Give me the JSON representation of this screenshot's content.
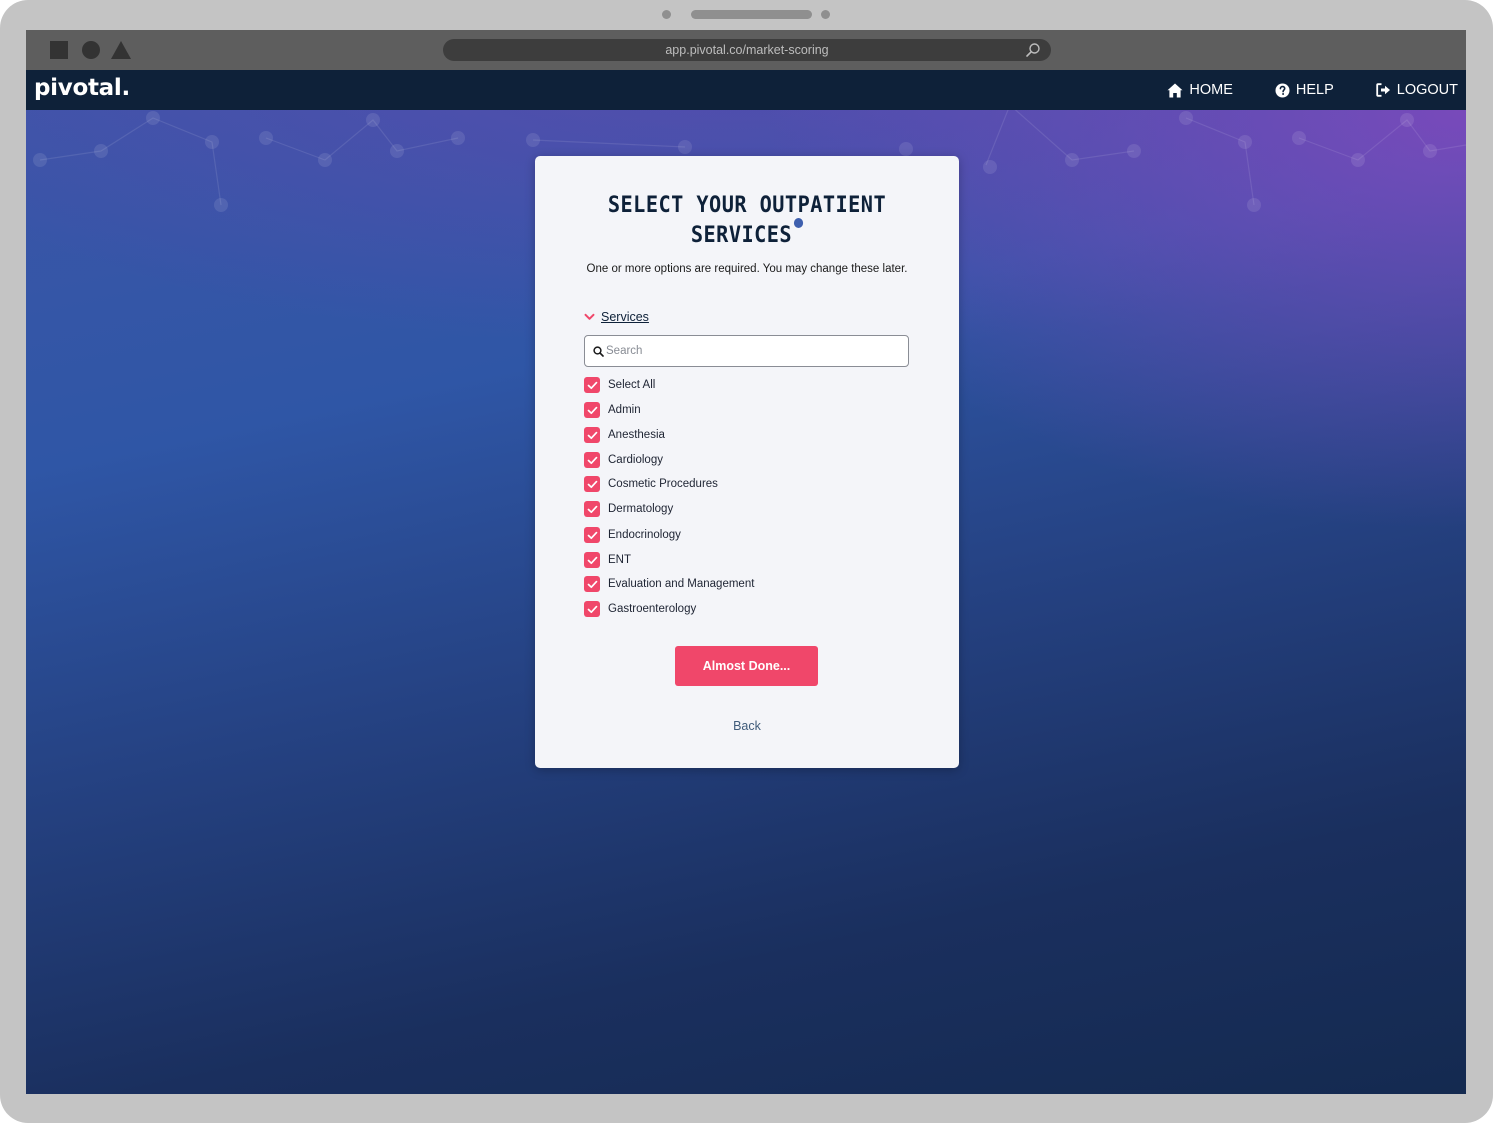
{
  "browser": {
    "url": "app.pivotal.co/market-scoring"
  },
  "app": {
    "logo": "pivotal."
  },
  "nav": {
    "items": [
      {
        "label": "HOME",
        "icon": "home-icon"
      },
      {
        "label": "HELP",
        "icon": "help-icon"
      },
      {
        "label": "LOGOUT",
        "icon": "logout-icon"
      }
    ]
  },
  "card": {
    "title": "SELECT YOUR OUTPATIENT SERVICES",
    "subtitle": "One or more options are required. You may change these later.",
    "section_label": "Services",
    "search_placeholder": "Search",
    "options": [
      {
        "label": "Select All",
        "checked": true
      },
      {
        "label": "Admin",
        "checked": true
      },
      {
        "label": "Anesthesia",
        "checked": true
      },
      {
        "label": "Cardiology",
        "checked": true
      },
      {
        "label": "Cosmetic Procedures",
        "checked": true
      },
      {
        "label": "Dermatology",
        "checked": true
      },
      {
        "label": "Endocrinology",
        "checked": true
      },
      {
        "label": "ENT",
        "checked": true
      },
      {
        "label": "Evaluation and Management",
        "checked": true
      },
      {
        "label": "Gastroenterology",
        "checked": true
      }
    ],
    "primary_button": "Almost Done...",
    "back_link": "Back"
  },
  "colors": {
    "nav_bg": "#0e2139",
    "accent": "#f0476a",
    "info": "#3e5fae"
  }
}
